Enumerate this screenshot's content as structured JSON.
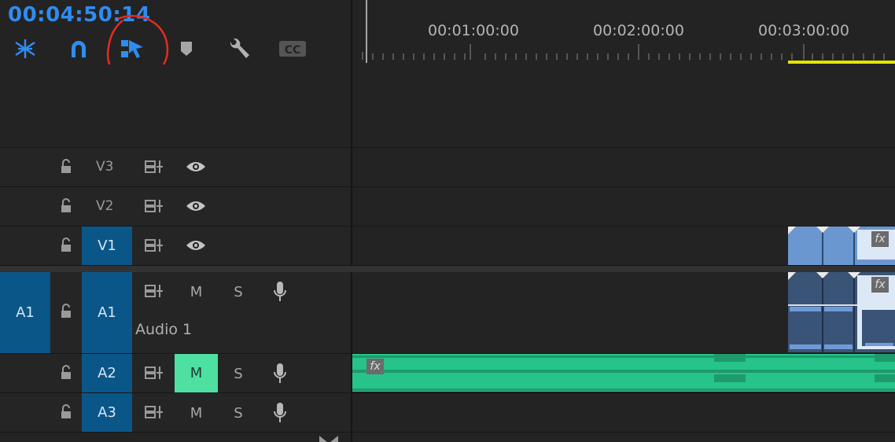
{
  "timecode": "00:04:50:14",
  "ruler": {
    "labels": [
      "00:01:00:00",
      "00:02:00:00",
      "00:03:00:00"
    ]
  },
  "tracks": {
    "v3": {
      "label": "V3"
    },
    "v2": {
      "label": "V2"
    },
    "v1": {
      "label": "V1"
    },
    "a1": {
      "source_label": "A1",
      "label": "A1",
      "name": "Audio 1",
      "mute": "M",
      "solo": "S"
    },
    "a2": {
      "label": "A2",
      "mute": "M",
      "solo": "S"
    },
    "a3": {
      "label": "A3",
      "mute": "M",
      "solo": "S"
    }
  },
  "clips": {
    "fx_label": "fx"
  },
  "colors": {
    "accent": "#2f8cf0",
    "track_target": "#0b5688",
    "mute_active": "#4ee0a0",
    "audio_clip": "#26c48a",
    "video_clip": "#6a97cf",
    "work_area": "#e4e400",
    "annotation": "#e52b20"
  }
}
